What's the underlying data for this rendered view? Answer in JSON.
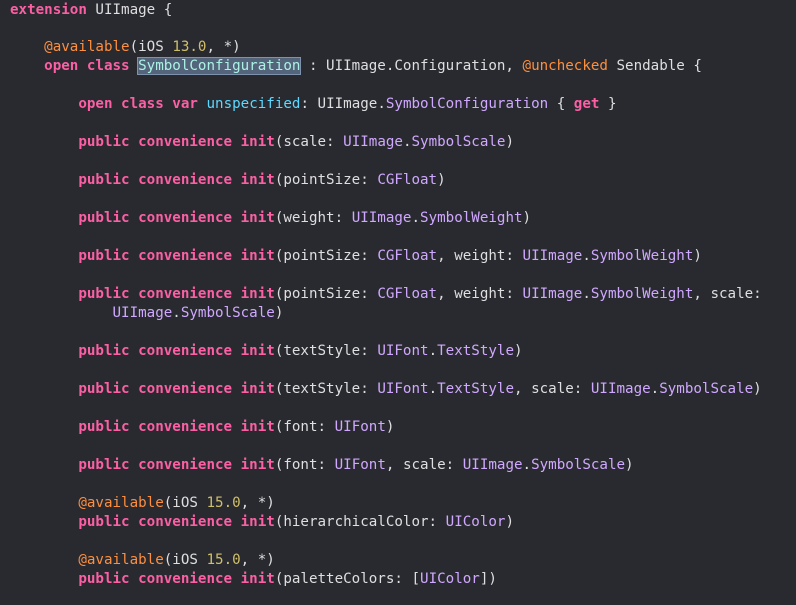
{
  "colors": {
    "background": "#292a30",
    "keyword": "#fc5fa3",
    "attribute": "#fd8f3f",
    "number": "#d0bf69",
    "type": "#d0a8ff",
    "plain": "#dfdfe0",
    "highlight": "#54647a"
  },
  "lines": [
    [
      {
        "t": "extension",
        "c": "kw"
      },
      {
        "t": " UIImage {",
        "c": "plain"
      }
    ],
    [],
    [
      {
        "t": "    "
      },
      {
        "t": "@available",
        "c": "attr"
      },
      {
        "t": "(iOS ",
        "c": "plain"
      },
      {
        "t": "13.0",
        "c": "num"
      },
      {
        "t": ", *)",
        "c": "plain"
      }
    ],
    [
      {
        "t": "    "
      },
      {
        "t": "open class",
        "c": "kw"
      },
      {
        "t": " "
      },
      {
        "t": "SymbolConfiguration",
        "c": "hl"
      },
      {
        "t": " : UIImage.Configuration, ",
        "c": "plain"
      },
      {
        "t": "@unchecked",
        "c": "attr"
      },
      {
        "t": " Sendable {",
        "c": "plain"
      }
    ],
    [],
    [
      {
        "t": "        "
      },
      {
        "t": "open class var",
        "c": "kw"
      },
      {
        "t": " "
      },
      {
        "t": "unspecified",
        "c": "proj2"
      },
      {
        "t": ": UIImage.",
        "c": "plain"
      },
      {
        "t": "SymbolConfiguration",
        "c": "type"
      },
      {
        "t": " { ",
        "c": "plain"
      },
      {
        "t": "get",
        "c": "kw"
      },
      {
        "t": " }",
        "c": "plain"
      }
    ],
    [],
    [
      {
        "t": "        "
      },
      {
        "t": "public convenience init",
        "c": "kw"
      },
      {
        "t": "(scale: ",
        "c": "plain"
      },
      {
        "t": "UIImage",
        "c": "type"
      },
      {
        "t": ".",
        "c": "plain"
      },
      {
        "t": "SymbolScale",
        "c": "type"
      },
      {
        "t": ")",
        "c": "plain"
      }
    ],
    [],
    [
      {
        "t": "        "
      },
      {
        "t": "public convenience init",
        "c": "kw"
      },
      {
        "t": "(pointSize: ",
        "c": "plain"
      },
      {
        "t": "CGFloat",
        "c": "type"
      },
      {
        "t": ")",
        "c": "plain"
      }
    ],
    [],
    [
      {
        "t": "        "
      },
      {
        "t": "public convenience init",
        "c": "kw"
      },
      {
        "t": "(weight: ",
        "c": "plain"
      },
      {
        "t": "UIImage",
        "c": "type"
      },
      {
        "t": ".",
        "c": "plain"
      },
      {
        "t": "SymbolWeight",
        "c": "type"
      },
      {
        "t": ")",
        "c": "plain"
      }
    ],
    [],
    [
      {
        "t": "        "
      },
      {
        "t": "public convenience init",
        "c": "kw"
      },
      {
        "t": "(pointSize: ",
        "c": "plain"
      },
      {
        "t": "CGFloat",
        "c": "type"
      },
      {
        "t": ", weight: ",
        "c": "plain"
      },
      {
        "t": "UIImage",
        "c": "type"
      },
      {
        "t": ".",
        "c": "plain"
      },
      {
        "t": "SymbolWeight",
        "c": "type"
      },
      {
        "t": ")",
        "c": "plain"
      }
    ],
    [],
    [
      {
        "t": "        "
      },
      {
        "t": "public convenience init",
        "c": "kw"
      },
      {
        "t": "(pointSize: ",
        "c": "plain"
      },
      {
        "t": "CGFloat",
        "c": "type"
      },
      {
        "t": ", weight: ",
        "c": "plain"
      },
      {
        "t": "UIImage",
        "c": "type"
      },
      {
        "t": ".",
        "c": "plain"
      },
      {
        "t": "SymbolWeight",
        "c": "type"
      },
      {
        "t": ", scale:",
        "c": "plain"
      }
    ],
    [
      {
        "t": "            "
      },
      {
        "t": "UIImage",
        "c": "type"
      },
      {
        "t": ".",
        "c": "plain"
      },
      {
        "t": "SymbolScale",
        "c": "type"
      },
      {
        "t": ")",
        "c": "plain"
      }
    ],
    [],
    [
      {
        "t": "        "
      },
      {
        "t": "public convenience init",
        "c": "kw"
      },
      {
        "t": "(textStyle: ",
        "c": "plain"
      },
      {
        "t": "UIFont",
        "c": "type"
      },
      {
        "t": ".",
        "c": "plain"
      },
      {
        "t": "TextStyle",
        "c": "type"
      },
      {
        "t": ")",
        "c": "plain"
      }
    ],
    [],
    [
      {
        "t": "        "
      },
      {
        "t": "public convenience init",
        "c": "kw"
      },
      {
        "t": "(textStyle: ",
        "c": "plain"
      },
      {
        "t": "UIFont",
        "c": "type"
      },
      {
        "t": ".",
        "c": "plain"
      },
      {
        "t": "TextStyle",
        "c": "type"
      },
      {
        "t": ", scale: ",
        "c": "plain"
      },
      {
        "t": "UIImage",
        "c": "type"
      },
      {
        "t": ".",
        "c": "plain"
      },
      {
        "t": "SymbolScale",
        "c": "type"
      },
      {
        "t": ")",
        "c": "plain"
      }
    ],
    [],
    [
      {
        "t": "        "
      },
      {
        "t": "public convenience init",
        "c": "kw"
      },
      {
        "t": "(font: ",
        "c": "plain"
      },
      {
        "t": "UIFont",
        "c": "type"
      },
      {
        "t": ")",
        "c": "plain"
      }
    ],
    [],
    [
      {
        "t": "        "
      },
      {
        "t": "public convenience init",
        "c": "kw"
      },
      {
        "t": "(font: ",
        "c": "plain"
      },
      {
        "t": "UIFont",
        "c": "type"
      },
      {
        "t": ", scale: ",
        "c": "plain"
      },
      {
        "t": "UIImage",
        "c": "type"
      },
      {
        "t": ".",
        "c": "plain"
      },
      {
        "t": "SymbolScale",
        "c": "type"
      },
      {
        "t": ")",
        "c": "plain"
      }
    ],
    [],
    [
      {
        "t": "        "
      },
      {
        "t": "@available",
        "c": "attr"
      },
      {
        "t": "(iOS ",
        "c": "plain"
      },
      {
        "t": "15.0",
        "c": "num"
      },
      {
        "t": ", *)",
        "c": "plain"
      }
    ],
    [
      {
        "t": "        "
      },
      {
        "t": "public convenience init",
        "c": "kw"
      },
      {
        "t": "(hierarchicalColor: ",
        "c": "plain"
      },
      {
        "t": "UIColor",
        "c": "type"
      },
      {
        "t": ")",
        "c": "plain"
      }
    ],
    [],
    [
      {
        "t": "        "
      },
      {
        "t": "@available",
        "c": "attr"
      },
      {
        "t": "(iOS ",
        "c": "plain"
      },
      {
        "t": "15.0",
        "c": "num"
      },
      {
        "t": ", *)",
        "c": "plain"
      }
    ],
    [
      {
        "t": "        "
      },
      {
        "t": "public convenience init",
        "c": "kw"
      },
      {
        "t": "(paletteColors: [",
        "c": "plain"
      },
      {
        "t": "UIColor",
        "c": "type"
      },
      {
        "t": "])",
        "c": "plain"
      }
    ]
  ]
}
